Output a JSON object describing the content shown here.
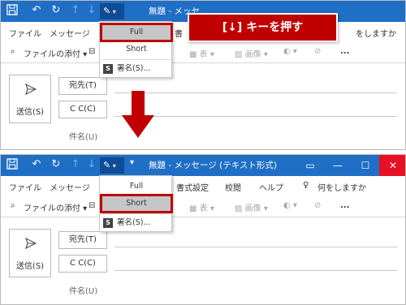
{
  "instruction_callout": "[↓] キーを押す",
  "window": {
    "title": "無題 - メッセージ (テキスト形式)",
    "title_top_partial": "無題 - メッセ"
  },
  "quick_access": {
    "icons": [
      "save-icon",
      "undo-icon",
      "redo-icon",
      "up-arrow-icon",
      "down-arrow-icon",
      "signature-icon",
      "dropdown-caret-icon"
    ]
  },
  "menu": {
    "file": "ファイル",
    "message": "メッセージ",
    "insert_partial_top": "書",
    "format": "書式設定",
    "review": "校閲",
    "help": "ヘルプ",
    "tell_me": "何をしますか",
    "tell_me_partial_top": "をしますか"
  },
  "toolbar": {
    "attach_file": "ファイルの添付",
    "table": "表",
    "image": "画像",
    "more": "..."
  },
  "compose": {
    "send_button": "送信(S)",
    "to_button": "宛先(T)",
    "cc_button": "C C(C)",
    "subject_label": "件名(U)"
  },
  "signature_menu": {
    "items": [
      {
        "label": "Full"
      },
      {
        "label": "Short"
      },
      {
        "label": "署名(S)..."
      }
    ],
    "selected_top": "Full",
    "selected_bottom": "Short"
  },
  "colors": {
    "titlebar": "#1f6fc7",
    "accent_red": "#c00000"
  }
}
